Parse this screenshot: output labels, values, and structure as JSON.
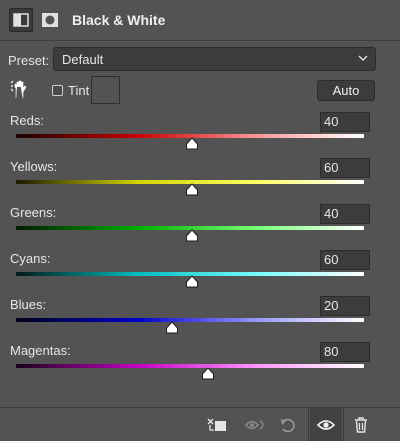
{
  "header": {
    "title": "Black & White",
    "icons": [
      "adjustment-layer-icon",
      "layer-mask-icon"
    ]
  },
  "preset": {
    "label": "Preset:",
    "value": "Default"
  },
  "tint": {
    "label": "Tint",
    "checked": false
  },
  "auto_label": "Auto",
  "sliders": [
    {
      "label": "Reds:",
      "value": "40",
      "fraction": 0.506,
      "gradient": [
        "#1a0000",
        "#cc0000",
        "#ff9a9a",
        "#ffffff"
      ]
    },
    {
      "label": "Yellows:",
      "value": "60",
      "fraction": 0.506,
      "gradient": [
        "#1a1a00",
        "#d4d400",
        "#ffff66",
        "#ffffff"
      ]
    },
    {
      "label": "Greens:",
      "value": "40",
      "fraction": 0.506,
      "gradient": [
        "#001a00",
        "#00b000",
        "#7aff7a",
        "#ffffff"
      ]
    },
    {
      "label": "Cyans:",
      "value": "60",
      "fraction": 0.506,
      "gradient": [
        "#001a1a",
        "#00bcbc",
        "#7affff",
        "#ffffff"
      ]
    },
    {
      "label": "Blues:",
      "value": "20",
      "fraction": 0.448,
      "gradient": [
        "#00001a",
        "#0000cc",
        "#9a9aff",
        "#ffffff"
      ]
    },
    {
      "label": "Magentas:",
      "value": "80",
      "fraction": 0.552,
      "gradient": [
        "#1a001a",
        "#c400c4",
        "#ff9aff",
        "#ffffff"
      ]
    }
  ],
  "footer": {
    "buttons": [
      "clip-to-layer-icon",
      "view-previous-state-icon",
      "reset-icon",
      "visibility-eye-icon",
      "trash-icon"
    ]
  }
}
